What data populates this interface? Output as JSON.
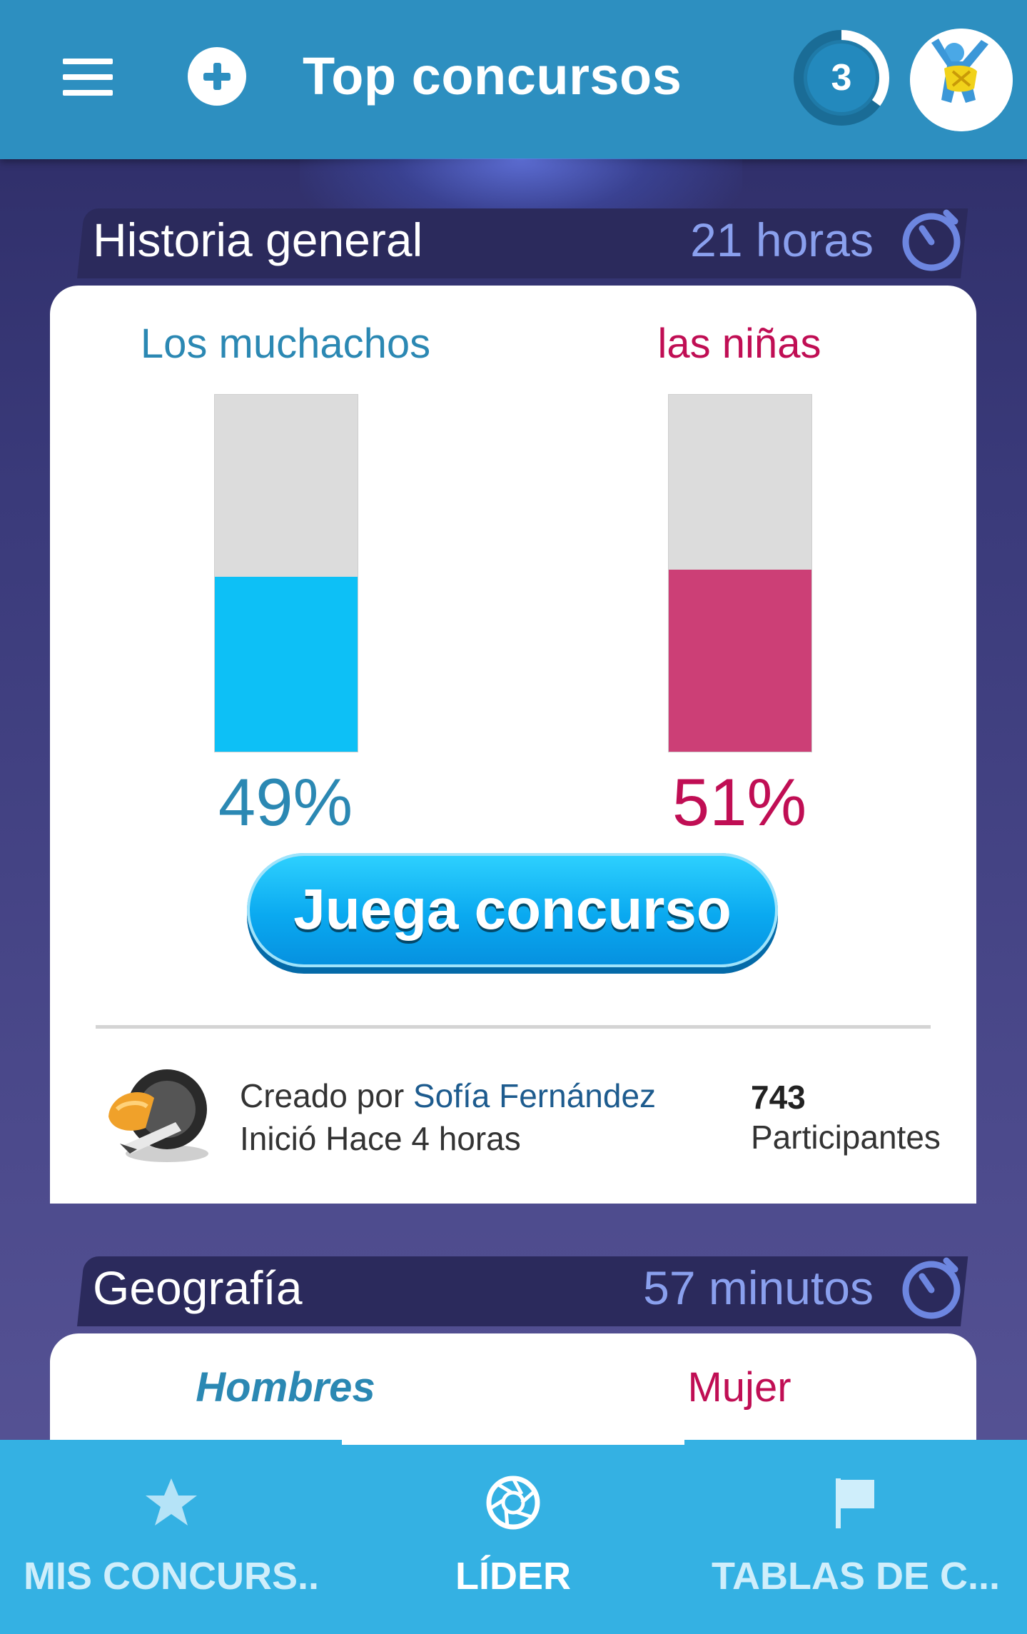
{
  "header": {
    "title": "Top concursos",
    "level": "3",
    "level_progress": 0.35
  },
  "contests": [
    {
      "category": "Historia general",
      "time_left": "21 horas",
      "team_a": {
        "name": "Los muchachos",
        "percent_label": "49%",
        "value": 49,
        "color": "#0dc0f6"
      },
      "team_b": {
        "name": "las niñas",
        "percent_label": "51%",
        "value": 51,
        "color": "#cc3f76"
      },
      "play_button": "Juega concurso",
      "creator_prefix": "Creado por",
      "creator_name": "Sofía Fernández",
      "started": "Inició Hace 4 horas",
      "participants_count": "743",
      "participants_label": "Participantes"
    },
    {
      "category": "Geografía",
      "time_left": "57 minutos",
      "team_a": {
        "name": "Hombres"
      },
      "team_b": {
        "name": "Mujer"
      }
    }
  ],
  "bottom_nav": [
    {
      "label": "MIS CONCURS..",
      "icon": "star-icon",
      "active": false
    },
    {
      "label": "LÍDER",
      "icon": "aperture-icon",
      "active": true
    },
    {
      "label": "TABLAS DE C...",
      "icon": "flag-icon",
      "active": false
    }
  ],
  "colors": {
    "header_bg": "#2d8fc0",
    "accent_blue": "#2b88b3",
    "accent_red": "#c00e54",
    "nav_bg": "#34b1e3"
  }
}
